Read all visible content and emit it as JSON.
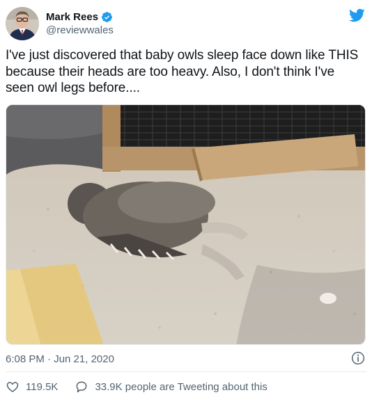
{
  "author": {
    "name": "Mark Rees",
    "handle": "@reviewwales",
    "verified": true
  },
  "tweet": {
    "text": "I've just discovered that baby owls sleep face down like THIS because their heads are too heavy. Also, I don't think I've seen owl legs before...."
  },
  "meta": {
    "timestamp": "6:08 PM · Jun 21, 2020"
  },
  "actions": {
    "likes": "119.5K",
    "conversation": "33.9K people are Tweeting about this"
  },
  "colors": {
    "brand_blue": "#1d9bf0",
    "secondary_text": "#536471",
    "primary_text": "#0f1419",
    "divider": "#e6ecf0"
  },
  "icons": {
    "verified": "verified-badge-icon",
    "logo": "twitter-bird-icon",
    "info": "info-icon",
    "like": "heart-icon",
    "conversation": "speech-bubble-icon"
  }
}
